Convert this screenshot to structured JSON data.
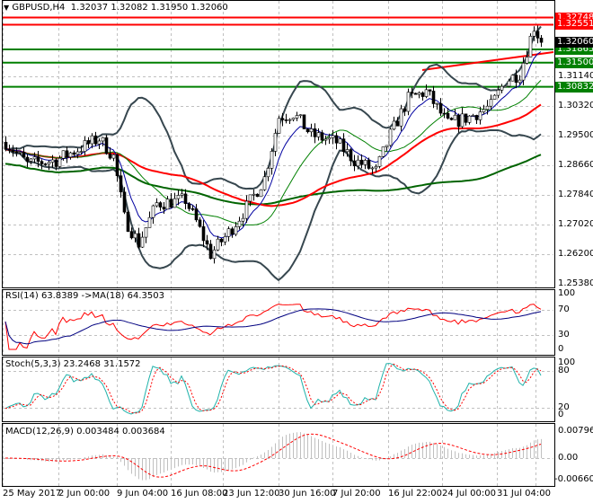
{
  "header": {
    "symbol": "GBPUSD,H4",
    "open": "1.32037",
    "high": "1.32082",
    "low": "1.31950",
    "close": "1.32060"
  },
  "price_axis": [
    "1.31140",
    "1.30320",
    "1.29500",
    "1.28660",
    "1.27840",
    "1.27020",
    "1.26200",
    "1.25380"
  ],
  "levels": [
    {
      "label": "1.32748",
      "value": 1.32748,
      "color": "#ff0000"
    },
    {
      "label": "1.32551",
      "value": 1.32551,
      "color": "#ff0000"
    },
    {
      "label": "1.31865",
      "value": 1.31865,
      "color": "#008000"
    },
    {
      "label": "1.31500",
      "value": 1.315,
      "color": "#008000"
    },
    {
      "label": "1.30832",
      "value": 1.30832,
      "color": "#008000"
    }
  ],
  "current_price": "1.32060",
  "price_anchors": [
    [
      0,
      1.293
    ],
    [
      6,
      1.287
    ],
    [
      14,
      1.288
    ],
    [
      26,
      1.294
    ],
    [
      30,
      1.289
    ],
    [
      33,
      1.272
    ],
    [
      37,
      1.265
    ],
    [
      42,
      1.276
    ],
    [
      50,
      1.277
    ],
    [
      53,
      1.271
    ],
    [
      57,
      1.262
    ],
    [
      62,
      1.268
    ],
    [
      67,
      1.275
    ],
    [
      72,
      1.283
    ],
    [
      76,
      1.3
    ],
    [
      80,
      1.301
    ],
    [
      85,
      1.295
    ],
    [
      92,
      1.293
    ],
    [
      97,
      1.288
    ],
    [
      103,
      1.285
    ],
    [
      107,
      1.295
    ],
    [
      112,
      1.305
    ],
    [
      117,
      1.307
    ],
    [
      123,
      1.298
    ],
    [
      129,
      1.3
    ],
    [
      135,
      1.303
    ],
    [
      139,
      1.31
    ],
    [
      143,
      1.312
    ],
    [
      147,
      1.325
    ],
    [
      149,
      1.3206
    ]
  ],
  "rsi": {
    "title": "RSI(14) 63.8389  ->MA(18) 64.3503",
    "axis": [
      "100",
      "70",
      "30",
      "0"
    ]
  },
  "stoch": {
    "title": "Stoch(5,3,3) 23.2468 31.1572",
    "axis": [
      "100",
      "80",
      "20",
      "0"
    ]
  },
  "macd": {
    "title": "MACD(12,26,9) 0.003484 0.003684",
    "axis": [
      "0.007961",
      "0.00",
      "-0.006601"
    ]
  },
  "time_axis": [
    "25 May 2017",
    "2 Jun 00:00",
    "9 Jun 04:00",
    "16 Jun 08:00",
    "23 Jun 12:00",
    "30 Jun 16:00",
    "7 Jul 20:00",
    "16 Jul 22:00",
    "24 Jul 00:00",
    "31 Jul 04:00"
  ],
  "colors": {
    "bull": "#ffffff",
    "bear": "#000000",
    "bands": "#37474f",
    "ma_fast": "#0000a0",
    "ma_mid": "#008000",
    "ma_red": "#ff0000",
    "ma_slow": "#006400",
    "rsi": "#ff0000",
    "rsi_ma": "#000080",
    "stoch_main": "#20b2aa",
    "stoch_signal": "#ff0000",
    "macd_hist": "#c0c0c0",
    "macd_signal": "#ff0000"
  }
}
